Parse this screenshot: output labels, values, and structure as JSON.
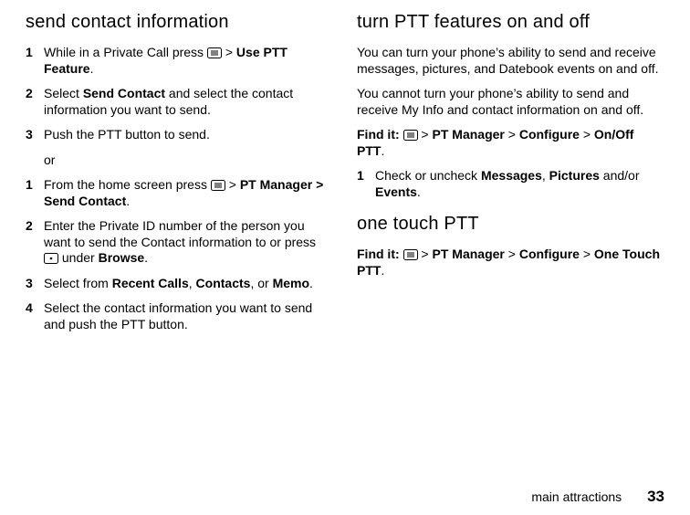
{
  "left": {
    "heading": "send contact information",
    "steps_a": [
      {
        "num": "1",
        "pre": "While in a Private Call press ",
        "icon": "menu-key",
        "post1": " > ",
        "bold1": "Use PTT Feature",
        "post2": "."
      },
      {
        "num": "2",
        "pre": "Select ",
        "bold1": "Send Contact",
        "post1": " and select the contact information you want to send."
      },
      {
        "num": "3",
        "pre": "Push the PTT button to send."
      }
    ],
    "or": "or",
    "steps_b": [
      {
        "num": "1",
        "pre": "From the home screen press ",
        "icon": "menu-key",
        "post1": " > ",
        "bold1": "PT Manager > Send Contact",
        "post2": "."
      },
      {
        "num": "2",
        "pre": "Enter the Private ID number of the person you want to send the Contact information to or press ",
        "icon": "soft-key",
        "post1": " under ",
        "bold1": "Browse",
        "post2": "."
      },
      {
        "num": "3",
        "pre": "Select from ",
        "bold1": "Recent Calls",
        "mid1": ", ",
        "bold2": "Contacts",
        "mid2": ", or ",
        "bold3": "Memo",
        "post2": "."
      },
      {
        "num": "4",
        "pre": "Select the contact information you want to send and push the PTT button."
      }
    ]
  },
  "right": {
    "heading1": "turn PTT features on and off",
    "para1": "You can turn your phone’s ability to send and receive messages, pictures, and Datebook events on and off.",
    "para2": "You cannot turn your phone’s ability to send and receive My Info and contact information on and off.",
    "findit_label": "Find it:",
    "findit1_path": [
      "PT Manager",
      "Configure",
      "On/Off PTT"
    ],
    "step1": {
      "num": "1",
      "pre": "Check or uncheck ",
      "b1": "Messages",
      "m1": ", ",
      "b2": "Pictures",
      "m2": " and/or ",
      "b3": "Events",
      "post": "."
    },
    "heading2": "one touch PTT",
    "findit2_path": [
      "PT Manager",
      "Configure",
      "One Touch PTT"
    ]
  },
  "footer": {
    "section": "main attractions",
    "page": "33"
  }
}
